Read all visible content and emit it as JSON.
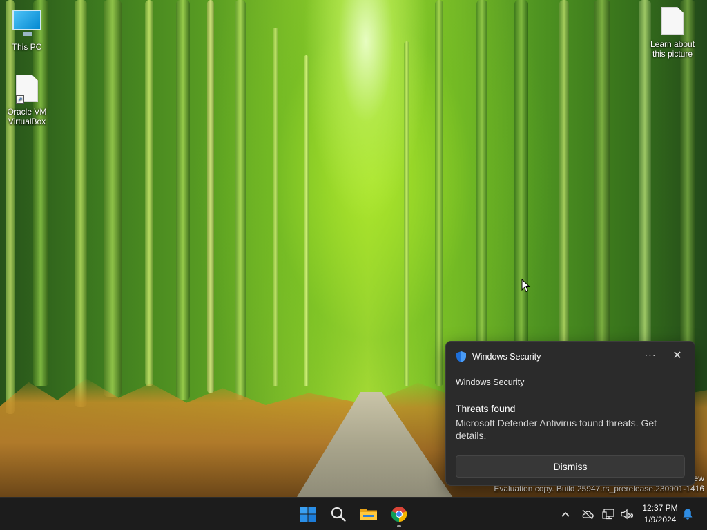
{
  "desktop": {
    "icons": [
      {
        "label": "This PC"
      },
      {
        "label": "Oracle VM VirtualBox"
      },
      {
        "label": "Learn about this picture"
      }
    ],
    "watermark": {
      "line1": "ew",
      "line2": "Evaluation copy. Build 25947.rs_prerelease.230901-1416"
    }
  },
  "notification": {
    "header_title": "Windows Security",
    "app_name": "Windows Security",
    "title": "Threats found",
    "body": "Microsoft Defender Antivirus found threats. Get details.",
    "more_label": "···",
    "close_label": "✕",
    "dismiss_label": "Dismiss"
  },
  "taskbar": {
    "apps": [
      {
        "name": "start-icon"
      },
      {
        "name": "search-icon"
      },
      {
        "name": "file-explorer-icon"
      },
      {
        "name": "chrome-icon"
      }
    ],
    "tray": {
      "chevron": "^",
      "time": "12:37 PM",
      "date": "1/9/2024"
    }
  },
  "colors": {
    "taskbar_bg": "#1c1c1c",
    "toast_bg": "#2b2b2b",
    "accent_blue": "#1a73e8"
  }
}
